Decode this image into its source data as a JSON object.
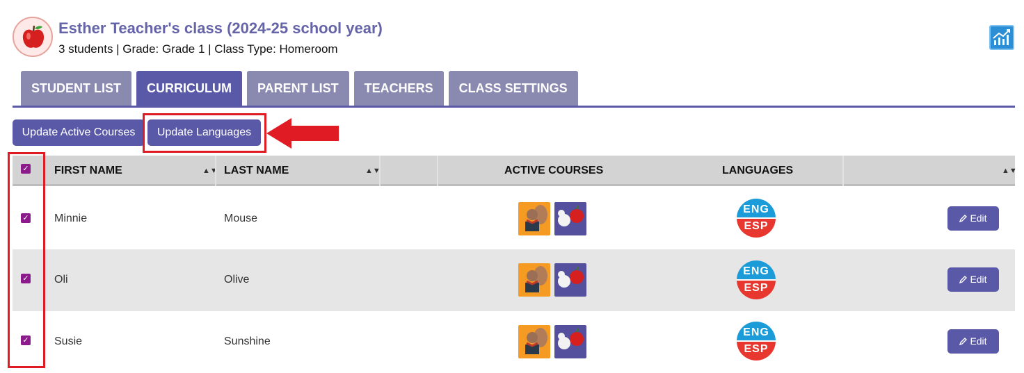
{
  "header": {
    "title": "Esther Teacher's class (2024-25 school year)",
    "subtitle": "3 students | Grade: Grade 1 | Class Type: Homeroom",
    "logo_icon": "apple-icon",
    "report_icon": "chart-report-icon"
  },
  "tabs": [
    {
      "label": "STUDENT LIST",
      "active": false
    },
    {
      "label": "CURRICULUM",
      "active": true
    },
    {
      "label": "PARENT LIST",
      "active": false
    },
    {
      "label": "TEACHERS",
      "active": false
    },
    {
      "label": "CLASS SETTINGS",
      "active": false
    }
  ],
  "actions": {
    "update_courses": "Update Active Courses",
    "update_languages": "Update Languages"
  },
  "table": {
    "columns": {
      "first_name": "FIRST NAME",
      "last_name": "LAST NAME",
      "active_courses": "ACTIVE COURSES",
      "languages": "LANGUAGES"
    },
    "rows": [
      {
        "first": "Minnie",
        "last": "Mouse",
        "courses": [
          "reading-squirrel-icon",
          "math-mouse-icon"
        ],
        "languages": [
          "ENG",
          "ESP"
        ],
        "checked": true,
        "edit": "Edit"
      },
      {
        "first": "Oli",
        "last": "Olive",
        "courses": [
          "reading-squirrel-icon",
          "math-mouse-icon"
        ],
        "languages": [
          "ENG",
          "ESP"
        ],
        "checked": true,
        "edit": "Edit"
      },
      {
        "first": "Susie",
        "last": "Sunshine",
        "courses": [
          "reading-squirrel-icon",
          "math-mouse-icon"
        ],
        "languages": [
          "ENG",
          "ESP"
        ],
        "checked": true,
        "edit": "Edit"
      }
    ]
  },
  "colors": {
    "accent": "#5a59a7",
    "tab_inactive": "#8a89b0",
    "title": "#6664a8",
    "checkbox": "#8b1a8b",
    "annotation": "#e01b24",
    "lang_top": "#1b9bd8",
    "lang_bottom": "#e8372f"
  }
}
